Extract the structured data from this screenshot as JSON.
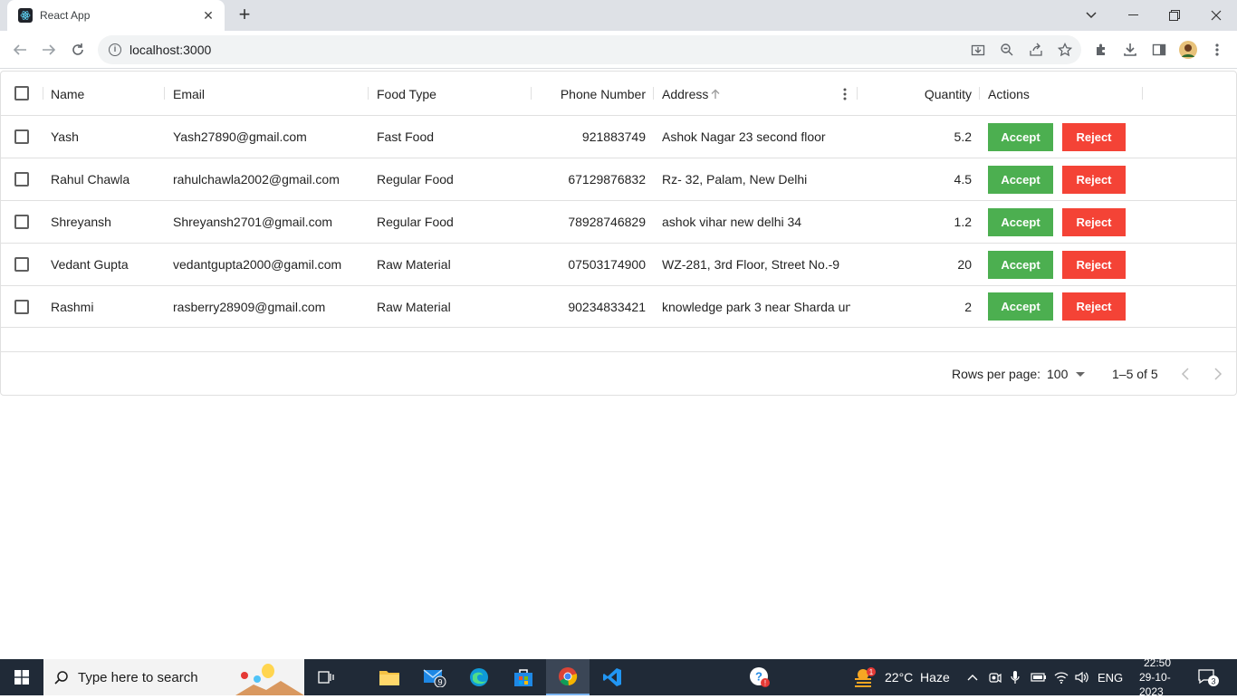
{
  "browser": {
    "tab_title": "React App",
    "url": "localhost:3000"
  },
  "grid": {
    "headers": {
      "name": "Name",
      "email": "Email",
      "food_type": "Food Type",
      "phone": "Phone Number",
      "address": "Address",
      "quantity": "Quantity",
      "actions": "Actions"
    },
    "rows": [
      {
        "name": "Yash",
        "email": "Yash27890@gmail.com",
        "food_type": "Fast Food",
        "phone": "921883749",
        "address": "Ashok Nagar 23 second floor",
        "quantity": "5.2"
      },
      {
        "name": "Rahul Chawla",
        "email": "rahulchawla2002@gmail.com",
        "food_type": "Regular Food",
        "phone": "67129876832",
        "address": "Rz- 32, Palam, New Delhi",
        "quantity": "4.5"
      },
      {
        "name": "Shreyansh",
        "email": "Shreyansh2701@gmail.com",
        "food_type": "Regular Food",
        "phone": "78928746829",
        "address": "ashok vihar new delhi 34",
        "quantity": "1.2"
      },
      {
        "name": "Vedant Gupta",
        "email": "vedantgupta2000@gamil.com",
        "food_type": "Raw Material",
        "phone": "07503174900",
        "address": "WZ-281, 3rd Floor, Street No.-9",
        "quantity": "20"
      },
      {
        "name": "Rashmi",
        "email": "rasberry28909@gmail.com",
        "food_type": "Raw Material",
        "phone": "90234833421",
        "address": "knowledge park 3 near Sharda un…",
        "quantity": "2"
      }
    ],
    "accept_label": "Accept",
    "reject_label": "Reject",
    "footer": {
      "rows_per_page_label": "Rows per page:",
      "rows_per_page_value": "100",
      "range": "1–5 of 5"
    }
  },
  "taskbar": {
    "search_placeholder": "Type here to search",
    "mail_badge": "9",
    "weather": "22°C  Haze",
    "weather_badge": "1",
    "language": "ENG",
    "time": "22:50",
    "date": "29-10-2023",
    "notification_count": "3"
  },
  "colors": {
    "accept": "#4caf50",
    "reject": "#f44336",
    "taskbar": "#202a37"
  }
}
